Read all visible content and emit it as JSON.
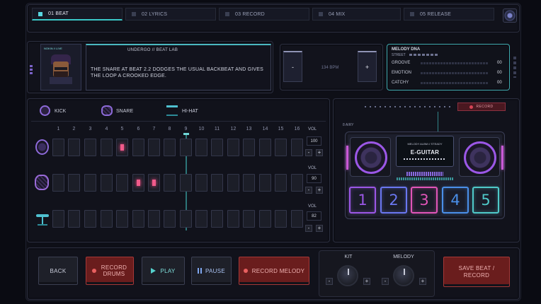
{
  "tabs": [
    {
      "label": "01 BEAT",
      "active": true
    },
    {
      "label": "02 LYRICS",
      "active": false
    },
    {
      "label": "03 RECORD",
      "active": false
    },
    {
      "label": "04 MIX",
      "active": false
    },
    {
      "label": "05 RELEASE",
      "active": false
    }
  ],
  "producer": {
    "badge": "NOKIN // LIVE",
    "title": "UNDERGO // BEAT LAB",
    "message": "THE SNARE AT BEAT 2.2 DODGES THE USUAL BACKBEAT AND GIVES THE LOOP A CROOKED EDGE."
  },
  "tempo": {
    "minus": "-",
    "plus": "+",
    "bpm": "134 BPM"
  },
  "melody_dna": {
    "title": "MELODY DNA",
    "street": "STREET",
    "rows": [
      {
        "label": "GROOVE",
        "value": "00"
      },
      {
        "label": "EMOTION",
        "value": "00"
      },
      {
        "label": "CATCHY",
        "value": "00"
      }
    ]
  },
  "sequencer": {
    "tracks": [
      {
        "name": "KICK",
        "vol_label": "VOL",
        "vol": "100",
        "active_steps": [
          5
        ]
      },
      {
        "name": "SNARE",
        "vol_label": "VOL",
        "vol": "90",
        "active_steps": [
          6,
          7
        ]
      },
      {
        "name": "HI-HAT",
        "vol_label": "VOL",
        "vol": "82",
        "active_steps": []
      }
    ],
    "steps": [
      "1",
      "2",
      "3",
      "4",
      "5",
      "6",
      "7",
      "8",
      "9",
      "10",
      "11",
      "12",
      "13",
      "14",
      "15",
      "16"
    ],
    "minus": "-",
    "plus": "+"
  },
  "machine": {
    "record_tag": "RECORD",
    "side_label": "8 AIRY",
    "screen_sub": "MELODY ALBM // STEADY",
    "instrument": "E-GUITAR",
    "pads": [
      {
        "label": "1",
        "color": "#9b57e6"
      },
      {
        "label": "2",
        "color": "#6a77f0"
      },
      {
        "label": "3",
        "color": "#e055b8"
      },
      {
        "label": "4",
        "color": "#4a8fe8"
      },
      {
        "label": "5",
        "color": "#4fc9c9"
      }
    ]
  },
  "controls": {
    "back": "BACK",
    "record_drums": "RECORD DRUMS",
    "play": "PLAY",
    "pause": "PAUSE",
    "record_melody": "RECORD MELODY",
    "kit": "KIT",
    "melody": "MELODY",
    "save": "SAVE BEAT / RECORD",
    "minus": "-",
    "plus": "+"
  }
}
